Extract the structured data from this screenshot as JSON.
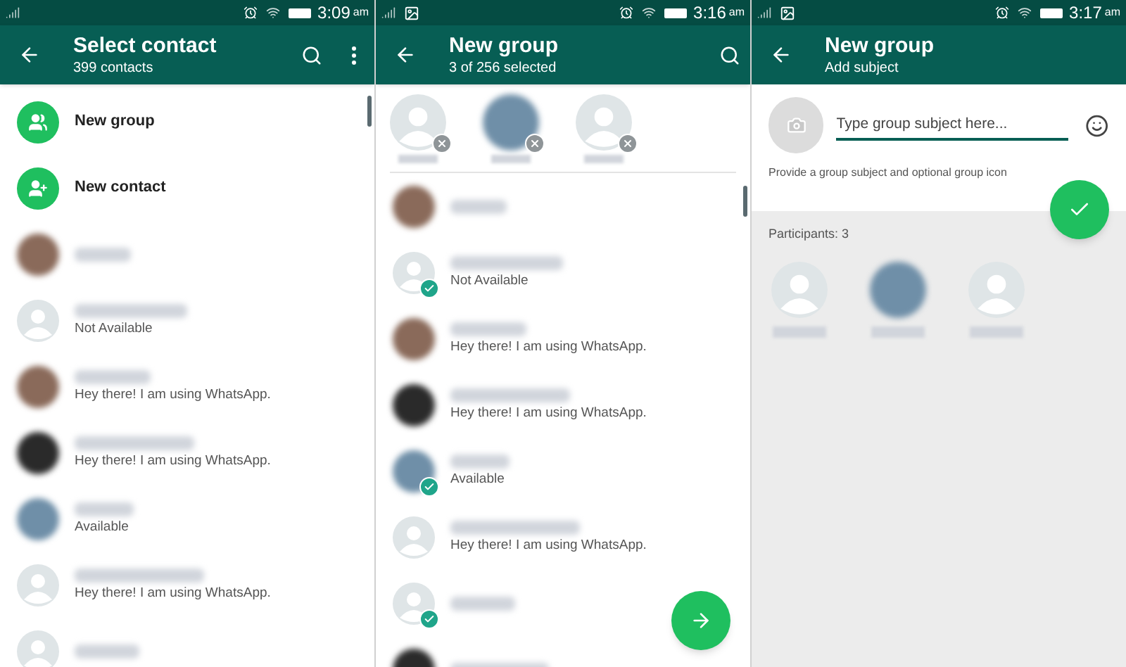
{
  "select_contact": {
    "status_bar": {
      "image_notification": false,
      "time": "3:09",
      "suffix": "am"
    },
    "title": "Select contact",
    "subtitle": "399 contacts",
    "actions": [
      {
        "kind": "group",
        "label": "New group"
      },
      {
        "kind": "contact",
        "label": "New contact"
      }
    ],
    "contacts": [
      {
        "kind": "photo_warm"
      },
      {
        "kind": "default",
        "status": "Not Available"
      },
      {
        "kind": "photo_warm",
        "status": "Hey there! I am using WhatsApp."
      },
      {
        "kind": "photo_dark",
        "status": "Hey there! I am using WhatsApp."
      },
      {
        "kind": "photo_sky",
        "status": "Available"
      },
      {
        "kind": "default",
        "status": "Hey there! I am using WhatsApp."
      },
      {
        "kind": "default"
      }
    ]
  },
  "new_group": {
    "status_bar": {
      "image_notification": true,
      "time": "3:16",
      "suffix": "am"
    },
    "title": "New group",
    "subtitle": "3 of 256 selected",
    "chips": [
      {
        "kind": "default"
      },
      {
        "kind": "photo_sky"
      },
      {
        "kind": "default"
      }
    ],
    "contacts": [
      {
        "kind": "photo_warm",
        "checked": false
      },
      {
        "kind": "default",
        "status": "Not Available",
        "checked": true
      },
      {
        "kind": "photo_warm",
        "status": "Hey there! I am using WhatsApp.",
        "checked": false
      },
      {
        "kind": "photo_dark",
        "status": "Hey there! I am using WhatsApp.",
        "checked": false
      },
      {
        "kind": "photo_sky",
        "status": "Available",
        "checked": true
      },
      {
        "kind": "default",
        "status": "Hey there! I am using WhatsApp.",
        "checked": false
      },
      {
        "kind": "default",
        "checked": true
      },
      {
        "kind": "photo_dark",
        "checked": false
      }
    ]
  },
  "add_subject": {
    "status_bar": {
      "image_notification": true,
      "time": "3:17",
      "suffix": "am"
    },
    "title": "New group",
    "subtitle": "Add subject",
    "subject": {
      "placeholder": "Type group subject here..."
    },
    "hint": "Provide a group subject and optional group icon",
    "participants_label": "Participants: 3",
    "participants": [
      {
        "kind": "default"
      },
      {
        "kind": "photo_sky"
      },
      {
        "kind": "default"
      }
    ]
  }
}
